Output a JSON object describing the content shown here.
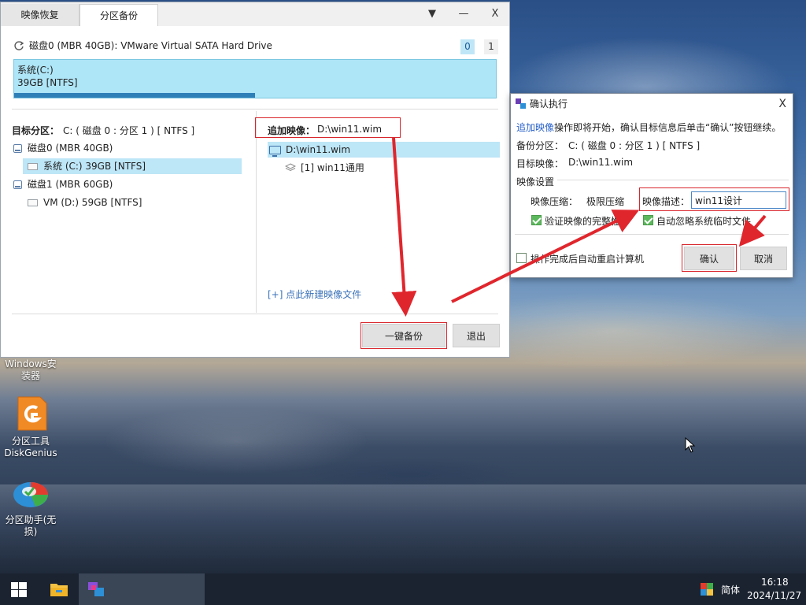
{
  "main_window": {
    "tabs": [
      "映像恢复",
      "分区备份"
    ],
    "controls": {
      "menu": "▼",
      "minimize": "—",
      "close": "X"
    },
    "disk_line": "磁盘0 (MBR 40GB): VMware Virtual SATA Hard Drive",
    "disk_selectors": [
      "0",
      "1"
    ],
    "partition_bar": {
      "label": "系统(C:)",
      "size": "39GB [NTFS]",
      "used_fraction": 0.5
    },
    "target_label": "目标分区：",
    "target_value": "C: ( 磁盘 0 : 分区 1 ) [ NTFS ]",
    "tree": [
      {
        "label": "磁盘0 (MBR 40GB)",
        "type": "disk"
      },
      {
        "label": "系统 (C:) 39GB [NTFS]",
        "type": "partition",
        "selected": true
      },
      {
        "label": "磁盘1 (MBR 60GB)",
        "type": "disk"
      },
      {
        "label": "VM (D:) 59GB [NTFS]",
        "type": "partition"
      }
    ],
    "append_label": "追加映像：",
    "append_value": "D:\\win11.wim",
    "image_file": "D:\\win11.wim",
    "image_entry": "[1] win11通用",
    "new_image_link": "[+] 点此新建映像文件",
    "backup_button": "一键备份",
    "exit_button": "退出"
  },
  "dialog": {
    "title": "确认执行",
    "close": "X",
    "intro_link": "追加映像",
    "intro_rest": "操作即将开始，确认目标信息后单击“确认”按钮继续。",
    "backup_partition_label": "备份分区：",
    "backup_partition_value": "C: ( 磁盘 0 : 分区 1 ) [ NTFS ]",
    "target_image_label": "目标映像：",
    "target_image_value": "D:\\win11.wim",
    "image_settings": "映像设置",
    "compression_label": "映像压缩：",
    "compression_value": "极限压缩",
    "description_label": "映像描述：",
    "description_value": "win11设计",
    "verify_label": "验证映像的完整性",
    "verify_checked": true,
    "ignore_temp_label": "自动忽略系统临时文件",
    "ignore_temp_checked": true,
    "reboot_label": "操作完成后自动重启计算机",
    "reboot_checked": false,
    "confirm_button": "确认",
    "cancel_button": "取消"
  },
  "desktop": {
    "icons": [
      {
        "label_line1": "Windows安",
        "label_line2": "装器",
        "icon": "windows-installer-icon"
      },
      {
        "label_line1": "分区工具",
        "label_line2": "DiskGenius",
        "icon": "diskgenius-icon"
      },
      {
        "label_line1": "分区助手(无",
        "label_line2": "损)",
        "icon": "partition-assistant-icon"
      }
    ]
  },
  "taskbar": {
    "ime": "简体",
    "time": "16:18",
    "date": "2024/11/27"
  },
  "colors": {
    "annotation_red": "#d9262d",
    "selection_blue": "#bde6f7",
    "partition_fill": "#aee5f7",
    "link_blue": "#2a62c9",
    "check_green": "#5cb85c"
  }
}
